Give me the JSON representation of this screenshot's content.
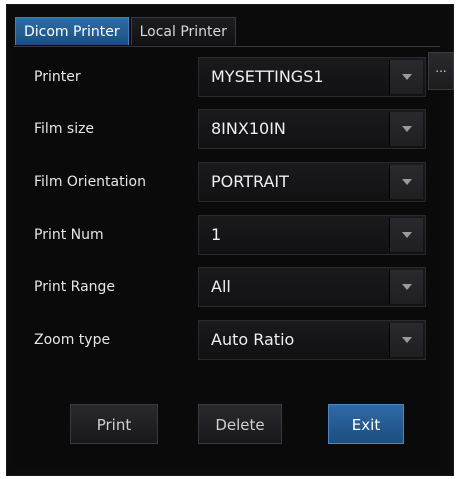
{
  "tabs": [
    {
      "label": "Dicom Printer",
      "active": true
    },
    {
      "label": "Local Printer",
      "active": false
    }
  ],
  "fields": {
    "printer": {
      "label": "Printer",
      "value": "MYSETTINGS1"
    },
    "film_size": {
      "label": "Film size",
      "value": "8INX10IN"
    },
    "film_orientation": {
      "label": "Film Orientation",
      "value": "PORTRAIT"
    },
    "print_num": {
      "label": "Print Num",
      "value": "1"
    },
    "print_range": {
      "label": "Print Range",
      "value": "All"
    },
    "zoom_type": {
      "label": "Zoom type",
      "value": "Auto Ratio"
    }
  },
  "more_button": "...",
  "actions": {
    "print": "Print",
    "delete": "Delete",
    "exit": "Exit"
  },
  "colors": {
    "accent": "#2d6ea7",
    "background": "#0b0b0c"
  }
}
